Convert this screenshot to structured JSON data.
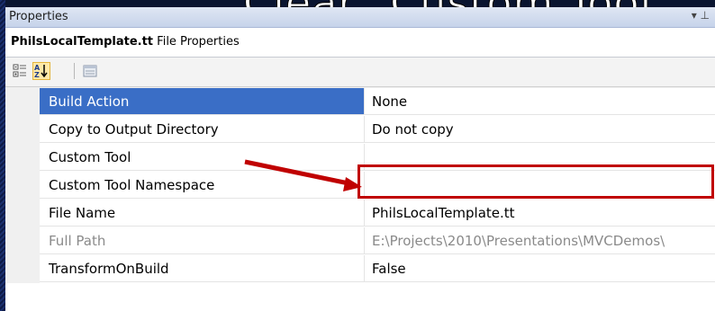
{
  "slide": {
    "title": "Clear \"Custom Tool\""
  },
  "panel": {
    "title": "Properties",
    "pin_glyph": "▾ ⊥",
    "object": {
      "file_name": "PhilsLocalTemplate.tt",
      "type_label": "File Properties"
    }
  },
  "toolbar": {
    "buttons": [
      {
        "name": "categorized-icon",
        "active": false
      },
      {
        "name": "alphabetical-sort-icon",
        "active": true
      },
      {
        "name": "property-pages-icon",
        "active": false
      }
    ]
  },
  "properties": [
    {
      "name": "Build Action",
      "value": "None",
      "selected": true,
      "disabled": false
    },
    {
      "name": "Copy to Output Directory",
      "value": "Do not copy",
      "selected": false,
      "disabled": false
    },
    {
      "name": "Custom Tool",
      "value": "",
      "selected": false,
      "disabled": false
    },
    {
      "name": "Custom Tool Namespace",
      "value": "",
      "selected": false,
      "disabled": false
    },
    {
      "name": "File Name",
      "value": "PhilsLocalTemplate.tt",
      "selected": false,
      "disabled": false
    },
    {
      "name": "Full Path",
      "value": "E:\\Projects\\2010\\Presentations\\MVCDemos\\",
      "selected": false,
      "disabled": true
    },
    {
      "name": "TransformOnBuild",
      "value": "False",
      "selected": false,
      "disabled": false
    }
  ],
  "annotation": {
    "color": "#c00000"
  },
  "colors": {
    "selection": "#3a6ec6",
    "titlebar": "#c6d3ea"
  }
}
